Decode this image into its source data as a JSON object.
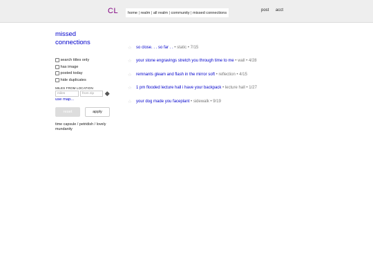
{
  "header": {
    "logo": "CL",
    "breadcrumbs": [
      "home",
      "realm",
      "all realm",
      "community",
      "missed connections"
    ],
    "links": {
      "post": "post",
      "account": "acct"
    }
  },
  "sidebar": {
    "title_line1": "missed",
    "title_line2": "connections",
    "filters": [
      {
        "label": "search titles only",
        "checked": false
      },
      {
        "label": "has image",
        "checked": false
      },
      {
        "label": "posted today",
        "checked": false
      },
      {
        "label": "hide duplicates",
        "checked": false
      }
    ],
    "miles_label": "MILES FROM LOCATION",
    "miles_placeholder": "miles",
    "zip_placeholder": "from zip",
    "use_map": "use map...",
    "reset": "reset",
    "apply": "apply",
    "subareas": "time capsule / petridish / lovely mundanity"
  },
  "results": [
    {
      "title": "so close. . . so far . .",
      "location": "static",
      "date": "7/15"
    },
    {
      "title": "your stone engravings stretch you through time to me",
      "location": "wall",
      "date": "4/28"
    },
    {
      "title": "remnants gleam and flash in the mirror soft",
      "location": "reflection",
      "date": "4/15"
    },
    {
      "title": "1 pm flooded lecture hall i have your backpack",
      "location": "lecture hall",
      "date": "1/27"
    },
    {
      "title": "your dog made you faceplant",
      "location": "sidewalk",
      "date": "9/19"
    }
  ],
  "colors": {
    "link": "#0000cc",
    "logo": "#800080",
    "header_bg": "#eeeeee",
    "meta": "#777777"
  }
}
